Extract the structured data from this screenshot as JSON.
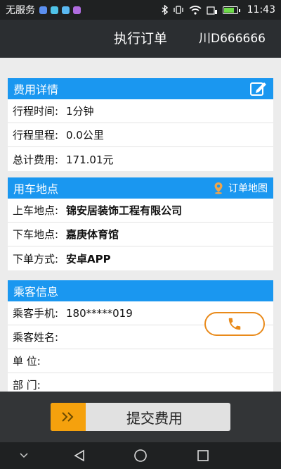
{
  "status_bar": {
    "carrier": "无服务",
    "time": "11:43",
    "app_icon_colors": [
      "#5b8ff0",
      "#4fc3e8",
      "#5ab9f2",
      "#b06ce0"
    ]
  },
  "header": {
    "title": "执行订单",
    "plate": "川D666666"
  },
  "fee_section": {
    "title": "费用详情",
    "rows": [
      {
        "label": "行程时间:",
        "value": "1分钟"
      },
      {
        "label": "行程里程:",
        "value": "0.0公里"
      },
      {
        "label": "总计费用:",
        "value": "171.01元"
      }
    ]
  },
  "location_section": {
    "title": "用车地点",
    "map_link": "订单地图",
    "rows": [
      {
        "label": "上车地点:",
        "value": "锦安居装饰工程有限公司"
      },
      {
        "label": "下车地点:",
        "value": "嘉庚体育馆"
      },
      {
        "label": "下单方式:",
        "value": "安卓APP"
      }
    ]
  },
  "passenger_section": {
    "title": "乘客信息",
    "rows": [
      {
        "label": "乘客手机:",
        "value": "180*****019"
      },
      {
        "label": "乘客姓名:",
        "value": ""
      },
      {
        "label": "单 位:",
        "value": ""
      },
      {
        "label": "部 门:",
        "value": ""
      }
    ]
  },
  "submit": {
    "label": "提交费用",
    "arrow": "»"
  },
  "colors": {
    "accent_blue": "#1a97f0",
    "accent_orange": "#f5a10d",
    "phone_orange": "#e98a1a"
  },
  "icons": {
    "edit": "edit-icon",
    "map_pin": "map-pin-icon",
    "phone": "phone-icon"
  }
}
